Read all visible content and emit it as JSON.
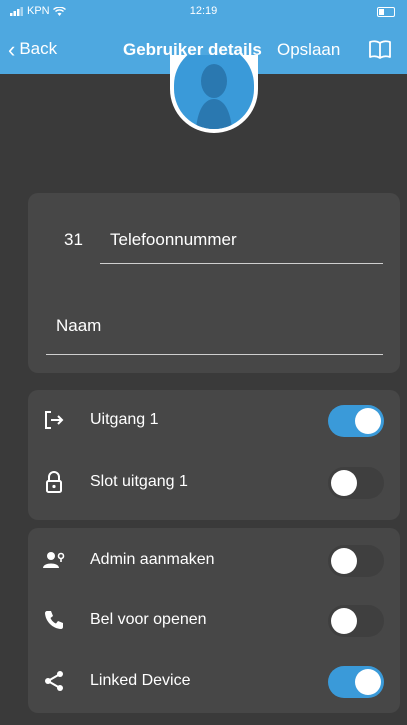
{
  "status_bar": {
    "carrier": "KPN",
    "time": "12:19"
  },
  "nav": {
    "back_label": "Back",
    "title": "Gebruiker details",
    "save_label": "Opslaan",
    "book_icon": "book-icon"
  },
  "form": {
    "country_code": "31",
    "phone_placeholder": "Telefoonnummer",
    "name_placeholder": "Naam"
  },
  "outputs": [
    {
      "label": "Uitgang 1",
      "icon": "exit-arrow-icon",
      "on": true
    },
    {
      "label": "Slot uitgang 1",
      "icon": "lock-icon",
      "on": false
    }
  ],
  "settings": [
    {
      "label": "Admin aanmaken",
      "icon": "add-admin-icon",
      "on": false
    },
    {
      "label": "Bel voor openen",
      "icon": "phone-icon",
      "on": false
    },
    {
      "label": "Linked Device",
      "icon": "share-icon",
      "on": true
    }
  ],
  "colors": {
    "accent": "#3a9ad9",
    "navbar": "#4ea8e0",
    "background": "#3a3a3a",
    "card": "#474747"
  }
}
